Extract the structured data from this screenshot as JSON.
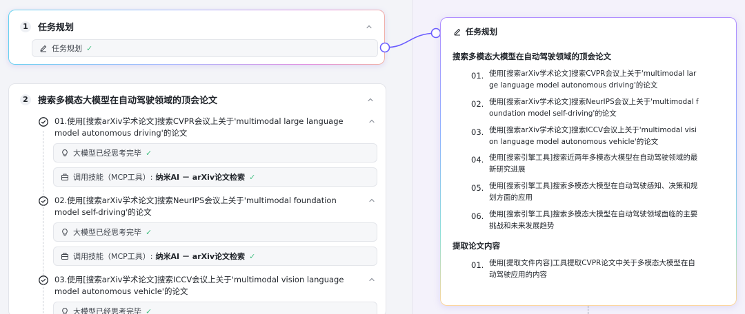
{
  "left": {
    "step1": {
      "number": "1",
      "title": "任务规划",
      "pill_label": "任务规划"
    },
    "step2": {
      "number": "2",
      "title": "搜索多模态大模型在自动驾驶领域的顶会论文",
      "tasks": [
        {
          "text": "01.使用[搜索arXiv学术论文]搜索CVPR会议上关于'multimodal large language model autonomous driving'的论文",
          "thinking": "大模型已经思考完毕",
          "tool_prefix": "调用技能（MCP工具）:",
          "tool_name": "纳米AI － arXiv论文检索"
        },
        {
          "text": "02.使用[搜索arXiv学术论文]搜索NeurIPS会议上关于'multimodal foundation model self-driving'的论文",
          "thinking": "大模型已经思考完毕",
          "tool_prefix": "调用技能（MCP工具）:",
          "tool_name": "纳米AI － arXiv论文检索"
        },
        {
          "text": "03.使用[搜索arXiv学术论文]搜索ICCV会议上关于'multimodal vision language model autonomous vehicle'的论文",
          "thinking": "大模型已经思考完毕"
        }
      ]
    }
  },
  "right": {
    "header": "任务规划",
    "sections": [
      {
        "title": "搜索多模态大模型在自动驾驶领域的顶会论文",
        "items": [
          {
            "num": "01.",
            "text": "使用[搜索arXiv学术论文]搜索CVPR会议上关于'multimodal large language model autonomous driving'的论文"
          },
          {
            "num": "02.",
            "text": "使用[搜索arXiv学术论文]搜索NeurIPS会议上关于'multimodal foundation model self-driving'的论文"
          },
          {
            "num": "03.",
            "text": "使用[搜索arXiv学术论文]搜索ICCV会议上关于'multimodal vision language model autonomous vehicle'的论文"
          },
          {
            "num": "04.",
            "text": "使用[搜索引擎工具]搜索近两年多模态大模型在自动驾驶领域的最新研究进展"
          },
          {
            "num": "05.",
            "text": "使用[搜索引擎工具]搜索多模态大模型在自动驾驶感知、决策和规划方面的应用"
          },
          {
            "num": "06.",
            "text": "使用[搜索引擎工具]搜索多模态大模型在自动驾驶领域面临的主要挑战和未来发展趋势"
          }
        ]
      },
      {
        "title": "提取论文内容",
        "items": [
          {
            "num": "01.",
            "text": "使用[提取文件内容]工具提取CVPR论文中关于多模态大模型在自动驾驶应用的内容"
          }
        ]
      }
    ]
  },
  "icons": {
    "check": "✓",
    "chevron": "chevron-up-icon",
    "edit": "edit-pen-icon",
    "bulb": "lightbulb-icon",
    "toolbox": "toolbox-icon",
    "done": "check-circle-icon"
  },
  "colors": {
    "accent": "#6a5cff",
    "success": "#3fbf7f"
  }
}
